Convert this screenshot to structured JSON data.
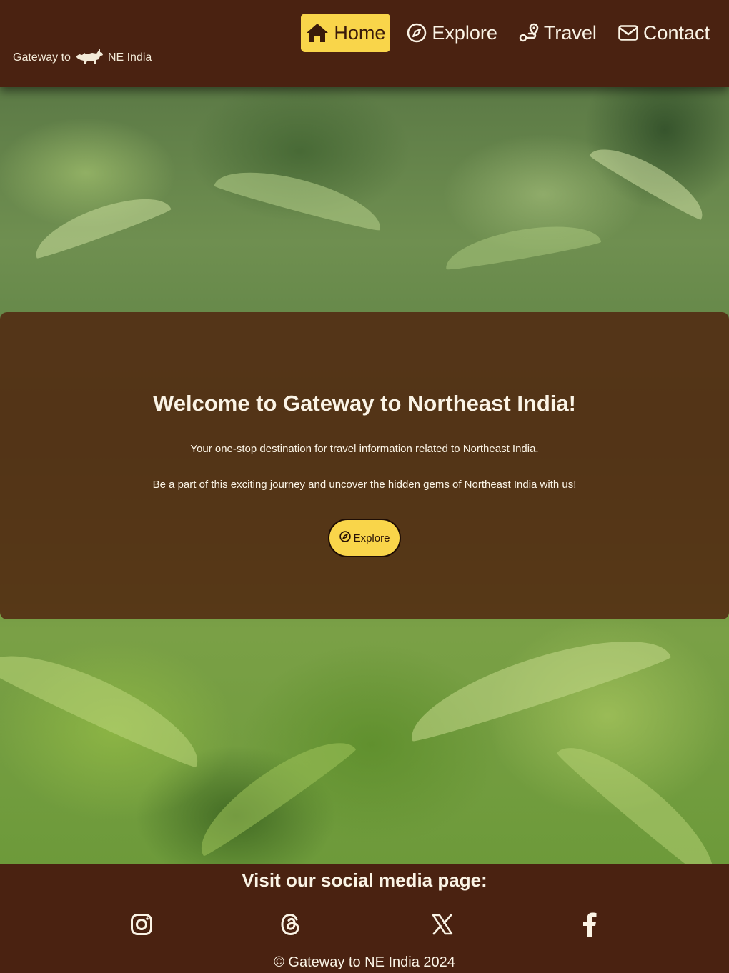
{
  "header": {
    "brand": {
      "prefix": "Gateway to",
      "suffix": "NE India",
      "logo_icon": "rhino-silhouette-icon"
    },
    "nav": [
      {
        "label": "Home",
        "icon": "home-icon",
        "active": true
      },
      {
        "label": "Explore",
        "icon": "compass-icon",
        "active": false
      },
      {
        "label": "Travel",
        "icon": "route-icon",
        "active": false
      },
      {
        "label": "Contact",
        "icon": "envelope-icon",
        "active": false
      }
    ]
  },
  "hero": {
    "title": "Welcome to Gateway to Northeast India!",
    "paragraph1": "Your one-stop destination for travel information related to Northeast India.",
    "paragraph2": "Be a part of this exciting journey and uncover the hidden gems of Northeast India with us!",
    "button_label": "Explore"
  },
  "footer": {
    "heading": "Visit our social media page:",
    "social": [
      "instagram-icon",
      "threads-icon",
      "x-icon",
      "facebook-icon"
    ],
    "copyright": "© Gateway to NE India 2024"
  },
  "colors": {
    "brown": "#4a2211",
    "accent": "#f9d54a",
    "text_light": "#fbf4e6"
  }
}
